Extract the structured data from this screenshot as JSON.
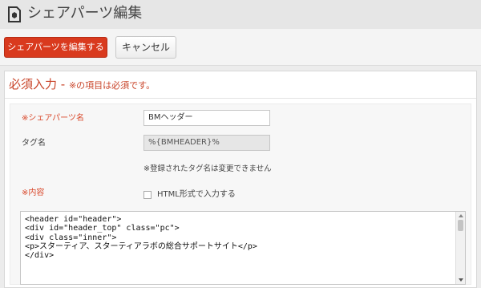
{
  "header": {
    "title": "シェアパーツ編集",
    "icon": "share-parts-icon"
  },
  "actions": {
    "edit_label": "シェアパーツを編集する",
    "cancel_label": "キャンセル"
  },
  "section": {
    "heading": "必須入力 -",
    "note": "※の項目は必須です。"
  },
  "form": {
    "name_label": "※シェアパーツ名",
    "name_value": "BMヘッダー",
    "tag_label": "タグ名",
    "tag_value": "%{BMHEADER}%",
    "tag_hint": "※登録されたタグ名は変更できません",
    "content_label": "※内容",
    "html_checkbox_label": "HTML形式で入力する",
    "content_lines": [
      "<header id=\"header\">",
      "<div id=\"header_top\" class=\"pc\">",
      "<div class=\"inner\">",
      "<p>スターティア、スターティアラボの総合サポートサイト</p>",
      "</div>"
    ]
  },
  "colors": {
    "accent": "#d93a1e",
    "required": "#d9482b"
  }
}
